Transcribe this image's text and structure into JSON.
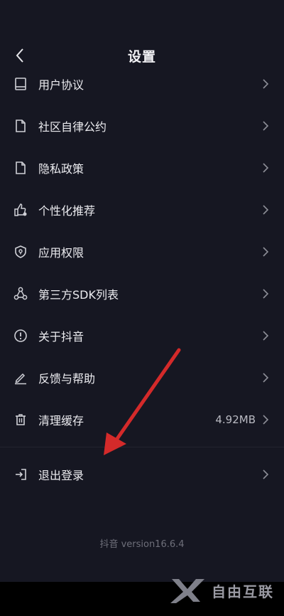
{
  "header": {
    "title": "设置"
  },
  "items": [
    {
      "label": "用户协议",
      "icon": "book-icon"
    },
    {
      "label": "社区自律公约",
      "icon": "document-icon"
    },
    {
      "label": "隐私政策",
      "icon": "document-icon"
    },
    {
      "label": "个性化推荐",
      "icon": "thumbs-up-icon"
    },
    {
      "label": "应用权限",
      "icon": "shield-icon"
    },
    {
      "label": "第三方SDK列表",
      "icon": "triangle-nodes-icon"
    },
    {
      "label": "关于抖音",
      "icon": "info-icon"
    },
    {
      "label": "反馈与帮助",
      "icon": "pen-icon"
    },
    {
      "label": "清理缓存",
      "icon": "trash-icon",
      "value": "4.92MB"
    }
  ],
  "logout": {
    "label": "退出登录",
    "icon": "logout-icon"
  },
  "footer": {
    "version": "抖音 version16.6.4"
  },
  "watermark": {
    "text": "自由互联"
  },
  "colors": {
    "background": "#161722",
    "annotation_arrow": "#d42a2a"
  }
}
